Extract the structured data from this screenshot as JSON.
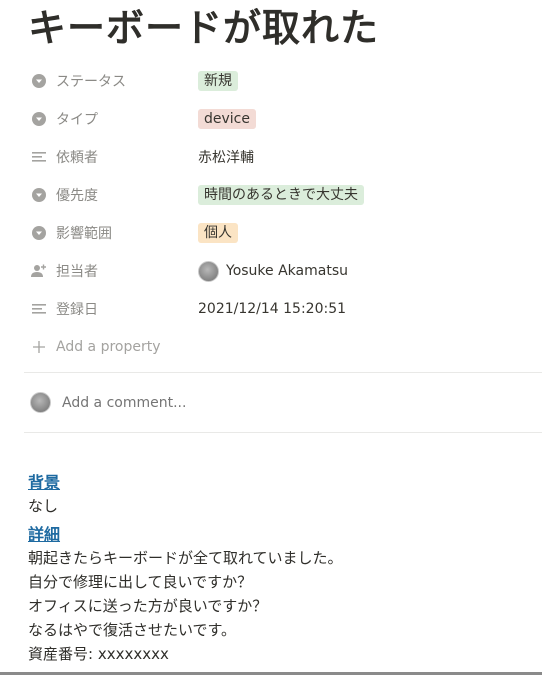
{
  "page": {
    "title": "キーボードが取れた"
  },
  "properties": [
    {
      "name": "ステータス",
      "icon": "select-icon",
      "type": "tag",
      "value": "新規",
      "tag_color": "#dbeddb"
    },
    {
      "name": "タイプ",
      "icon": "select-icon",
      "type": "tag",
      "value": "device",
      "tag_color": "#f3dbd5"
    },
    {
      "name": "依頼者",
      "icon": "text-icon",
      "type": "text",
      "value": "赤松洋輔"
    },
    {
      "name": "優先度",
      "icon": "select-icon",
      "type": "tag",
      "value": "時間のあるときで大丈夫",
      "tag_color": "#dbeddb"
    },
    {
      "name": "影響範囲",
      "icon": "select-icon",
      "type": "tag",
      "value": "個人",
      "tag_color": "#fbe4c4"
    },
    {
      "name": "担当者",
      "icon": "person-icon",
      "type": "person",
      "value": "Yosuke Akamatsu"
    },
    {
      "name": "登録日",
      "icon": "text-icon",
      "type": "text",
      "value": "2021/12/14 15:20:51"
    }
  ],
  "add_property": {
    "label": "Add a property"
  },
  "comment": {
    "placeholder": "Add a comment..."
  },
  "body": {
    "sections": [
      {
        "heading": "背景",
        "lines": [
          "なし"
        ]
      },
      {
        "heading": "詳細",
        "lines": [
          "朝起きたらキーボードが全て取れていました。",
          "自分で修理に出して良いですか？",
          "オフィスに送った方が良いですか？",
          "なるはやで復活させたいです。",
          "資産番号: xxxxxxxx"
        ]
      }
    ]
  }
}
